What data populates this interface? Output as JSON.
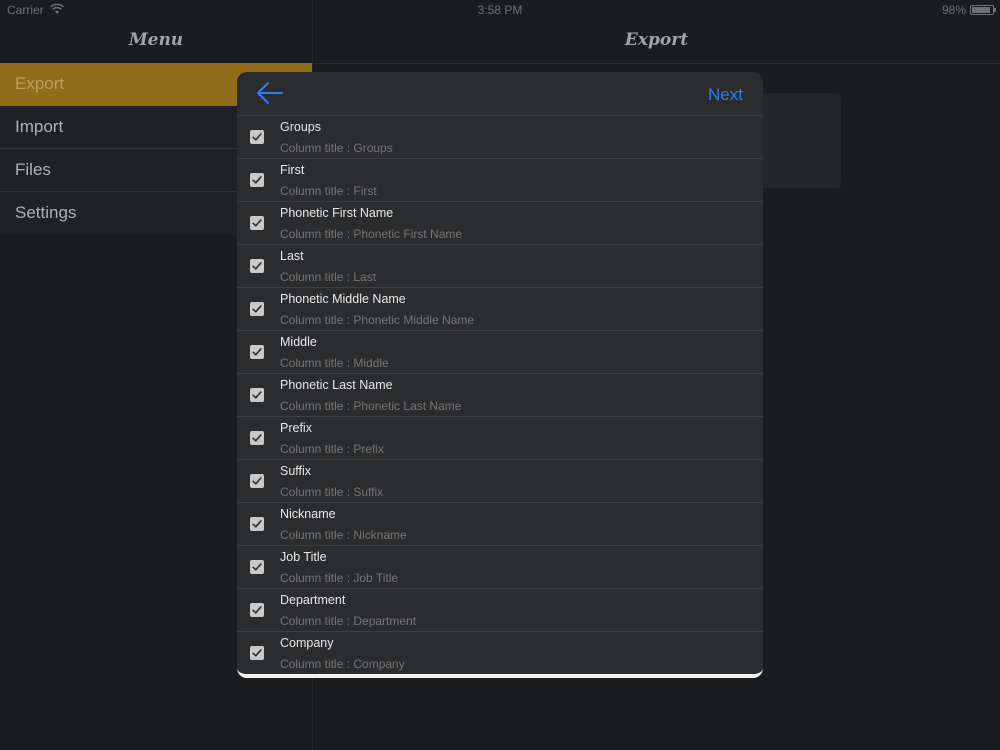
{
  "status_bar": {
    "carrier": "Carrier",
    "time": "3:58 PM",
    "battery": "98%"
  },
  "menu": {
    "title": "Menu",
    "items": [
      {
        "label": "Export",
        "active": true
      },
      {
        "label": "Import",
        "active": false
      },
      {
        "label": "Files",
        "active": false
      },
      {
        "label": "Settings",
        "active": false
      }
    ]
  },
  "main": {
    "title": "Export"
  },
  "modal": {
    "back_icon": "arrow-left-icon",
    "next_label": "Next",
    "fields": [
      {
        "name": "Groups",
        "placeholder": "Column title : Groups",
        "checked": true
      },
      {
        "name": "First",
        "placeholder": "Column title : First",
        "checked": true
      },
      {
        "name": "Phonetic First Name",
        "placeholder": "Column title : Phonetic First Name",
        "checked": true
      },
      {
        "name": "Last",
        "placeholder": "Column title : Last",
        "checked": true
      },
      {
        "name": "Phonetic Middle Name",
        "placeholder": "Column title : Phonetic Middle Name",
        "checked": true
      },
      {
        "name": "Middle",
        "placeholder": "Column title : Middle",
        "checked": true
      },
      {
        "name": "Phonetic Last Name",
        "placeholder": "Column title : Phonetic Last Name",
        "checked": true
      },
      {
        "name": "Prefix",
        "placeholder": "Column title : Prefix",
        "checked": true
      },
      {
        "name": "Suffix",
        "placeholder": "Column title : Suffix",
        "checked": true
      },
      {
        "name": "Nickname",
        "placeholder": "Column title : Nickname",
        "checked": true
      },
      {
        "name": "Job Title",
        "placeholder": "Column title : Job Title",
        "checked": true
      },
      {
        "name": "Department",
        "placeholder": "Column title : Department",
        "checked": true
      },
      {
        "name": "Company",
        "placeholder": "Column title : Company",
        "checked": true
      }
    ]
  },
  "colors": {
    "accent": "#2f7cf6",
    "menu_active": "#a57b1e",
    "background": "#1e2023",
    "modal_background": "#2b2c2e"
  }
}
